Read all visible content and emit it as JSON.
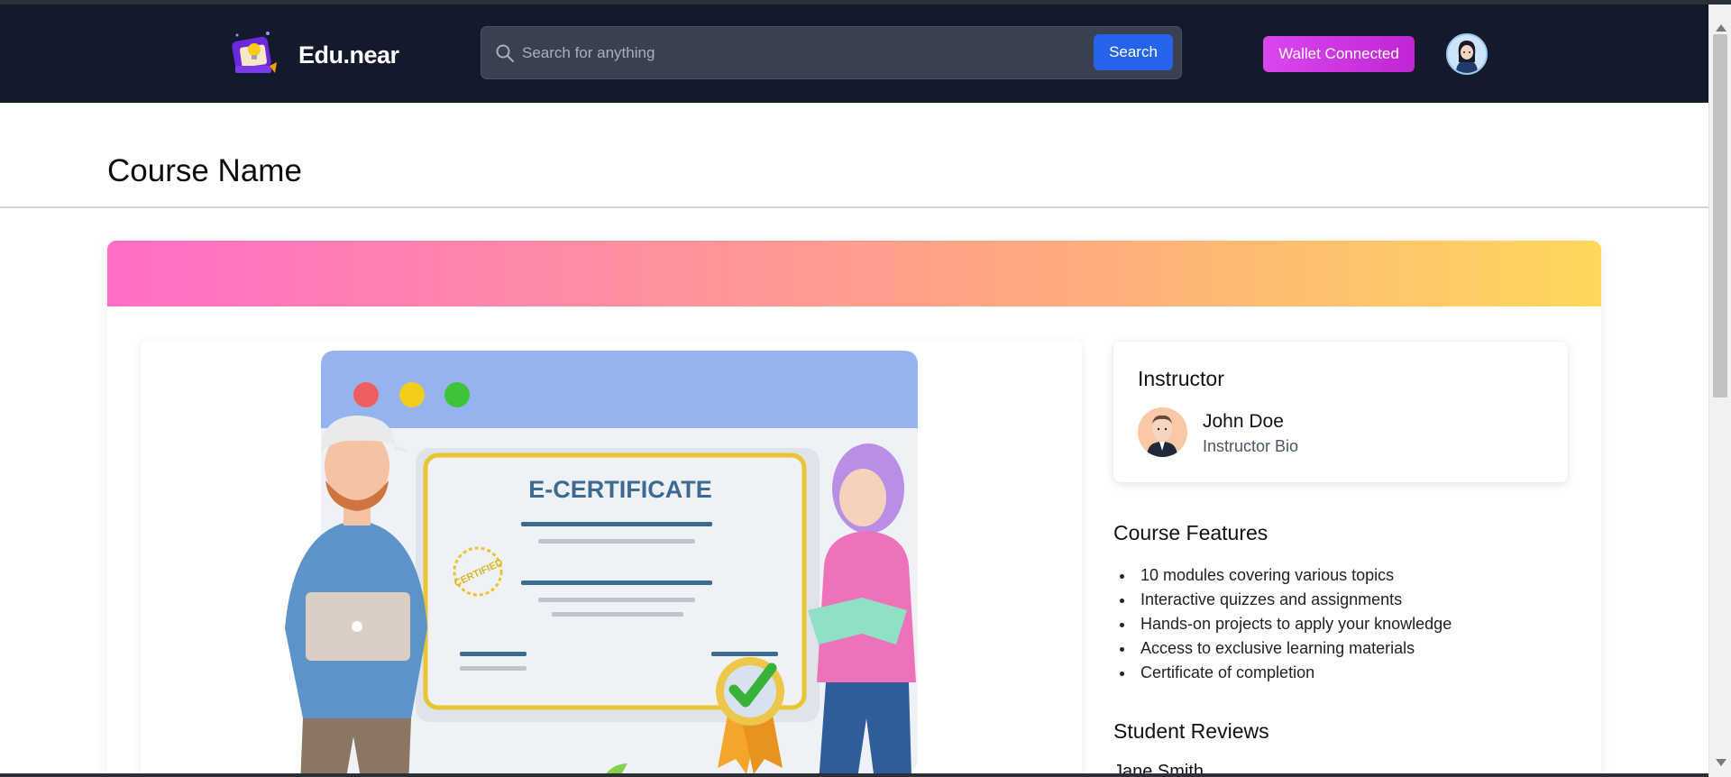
{
  "header": {
    "brand": "Edu.near",
    "search": {
      "placeholder": "Search for anything",
      "button_label": "Search"
    },
    "wallet_label": "Wallet Connected"
  },
  "page": {
    "title": "Course Name"
  },
  "instructor": {
    "heading": "Instructor",
    "name": "John Doe",
    "bio": "Instructor Bio"
  },
  "features": {
    "heading": "Course Features",
    "items": [
      "10 modules covering various topics",
      "Interactive quizzes and assignments",
      "Hands-on projects to apply your knowledge",
      "Access to exclusive learning materials",
      "Certificate of completion"
    ]
  },
  "reviews": {
    "heading": "Student Reviews",
    "items": [
      {
        "name": "Jane Smith"
      }
    ]
  },
  "illustration": {
    "certificate_title": "E-CERTIFICATE",
    "stamp_text": "CERTIFIED"
  },
  "colors": {
    "header_bg": "#121a2b",
    "search_button": "#2563eb",
    "wallet_button": "#d946ef",
    "banner_gradient": [
      "#ff6ec7",
      "#fdd85d"
    ]
  }
}
